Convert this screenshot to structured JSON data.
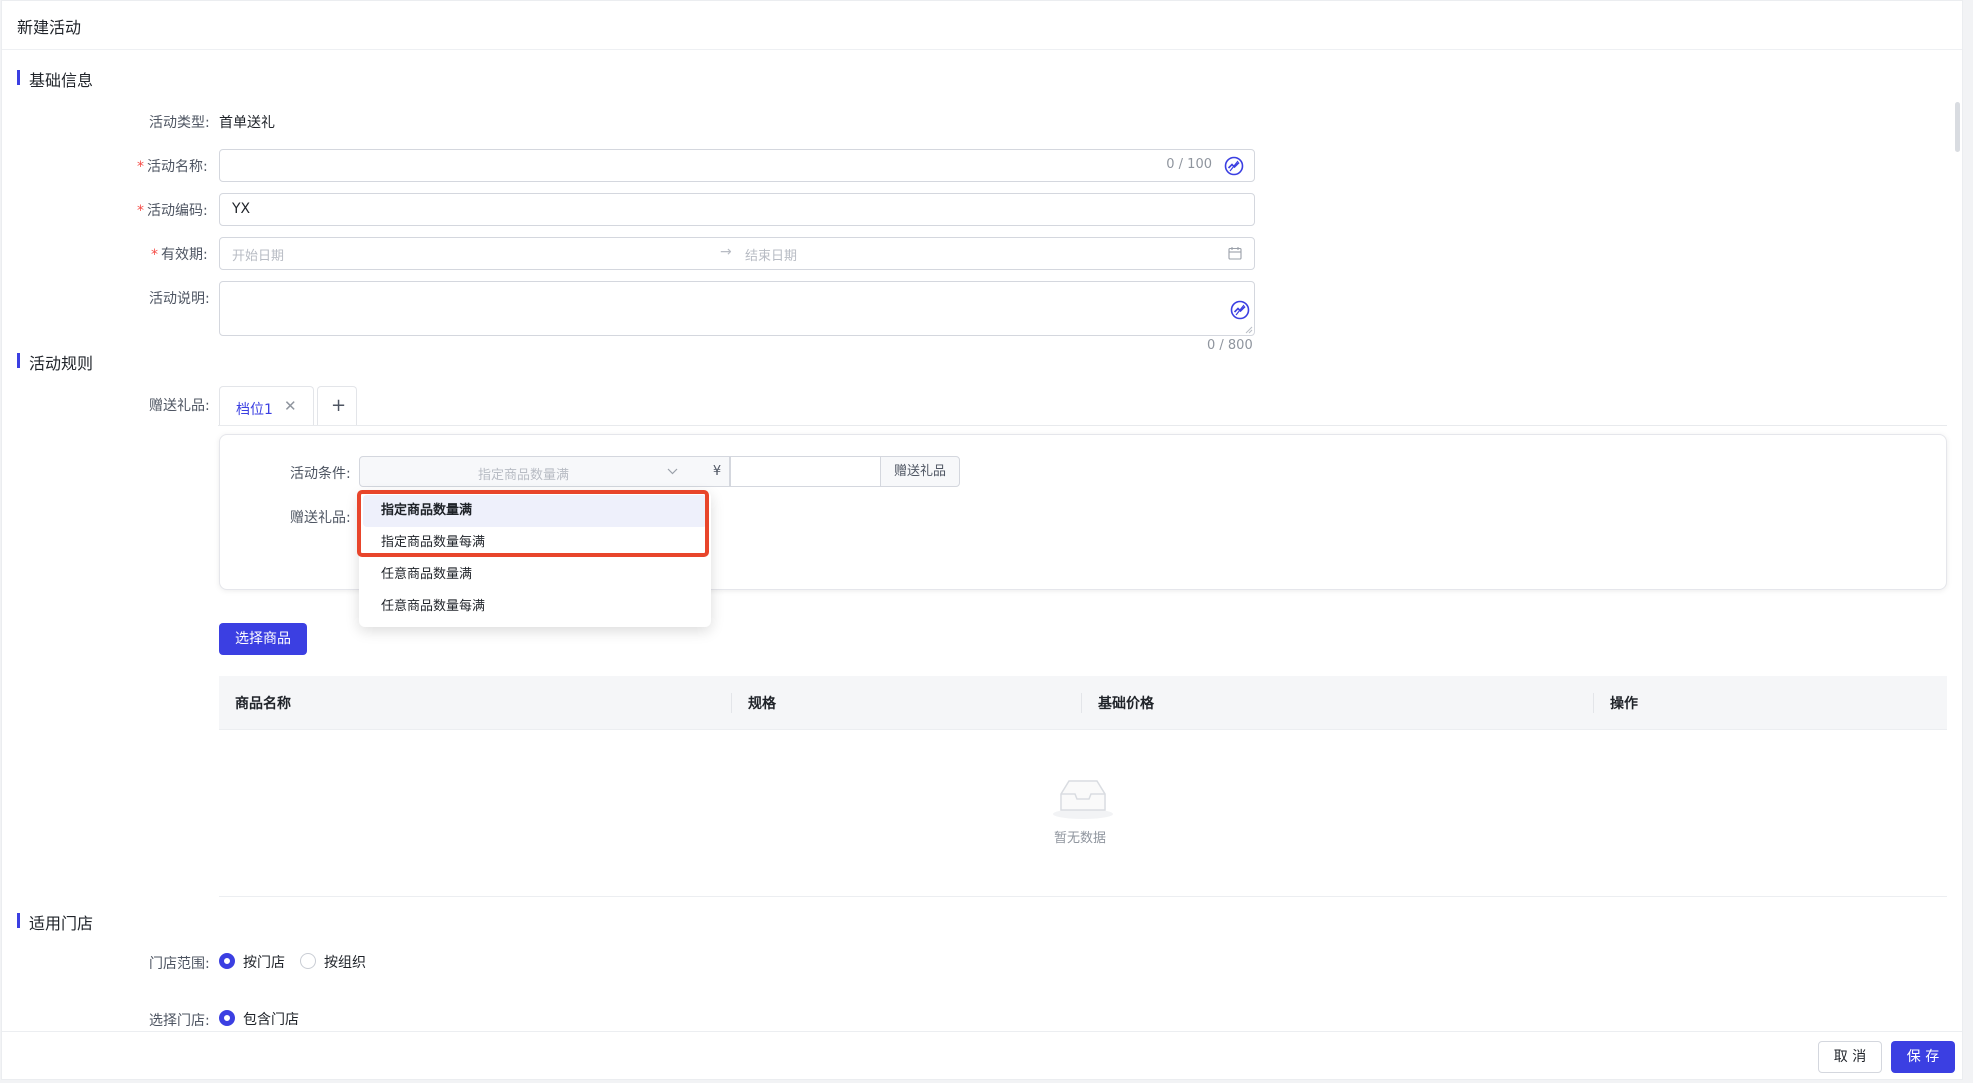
{
  "header": {
    "title": "新建活动"
  },
  "sections": {
    "basic": "基础信息",
    "rules": "活动规则",
    "stores": "适用门店"
  },
  "basic": {
    "type_label": "活动类型:",
    "type_value": "首单送礼",
    "name_label": "活动名称:",
    "name_value": "",
    "name_counter": "0 / 100",
    "code_label": "活动编码:",
    "code_value": "YX",
    "period_label": "有效期:",
    "start_placeholder": "开始日期",
    "end_placeholder": "结束日期",
    "desc_label": "活动说明:",
    "desc_counter": "0 / 800"
  },
  "rules": {
    "gift_label": "赠送礼品:",
    "tabs": [
      {
        "label": "档位1"
      }
    ],
    "add_tab": "+",
    "condition_label": "活动条件:",
    "condition_selected": "指定商品数量满",
    "currency": "¥",
    "gift_addon": "赠送礼品",
    "gift_row_label": "赠送礼品:",
    "dropdown_options": [
      "指定商品数量满",
      "指定商品数量每满",
      "任意商品数量满",
      "任意商品数量每满"
    ],
    "select_goods_button": "选择商品",
    "table": {
      "columns": [
        "商品名称",
        "规格",
        "基础价格",
        "操作"
      ],
      "rows": [],
      "empty_text": "暂无数据"
    }
  },
  "stores": {
    "scope_label": "门店范围:",
    "scope_options": [
      "按门店",
      "按组织"
    ],
    "scope_selected": "按门店",
    "select_label": "选择门店:",
    "select_options": [
      "包含门店"
    ],
    "select_selected": "包含门店"
  },
  "footer": {
    "cancel": "取 消",
    "save": "保 存"
  },
  "colors": {
    "accent": "#3b3fe2",
    "required": "#f54a45",
    "highlight": "#e8452b"
  }
}
